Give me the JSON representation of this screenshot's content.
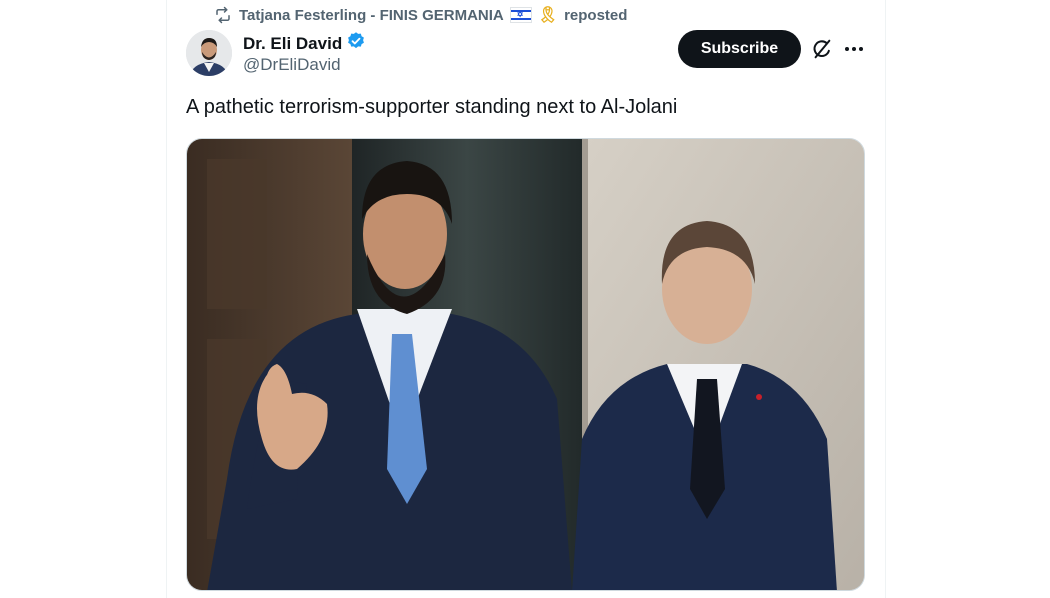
{
  "repost": {
    "user": "Tatjana Festerling - FINIS GERMANIA",
    "flag_icon": "israel-flag",
    "ribbon_icon": "yellow-ribbon",
    "action": "reposted"
  },
  "author": {
    "name": "Dr. Eli David",
    "handle": "@DrEliDavid",
    "verified": true,
    "verified_color": "#1d9bf0"
  },
  "actions": {
    "subscribe_label": "Subscribe",
    "grok_icon": "grok-icon",
    "more_icon": "more-icon"
  },
  "tweet": {
    "text": "A pathetic terrorism-supporter standing next to Al-Jolani"
  },
  "media": {
    "alt": "",
    "description_icon": "photo"
  },
  "colors": {
    "text_primary": "#0f1419",
    "text_secondary": "#536471",
    "button_bg": "#0f1419"
  }
}
